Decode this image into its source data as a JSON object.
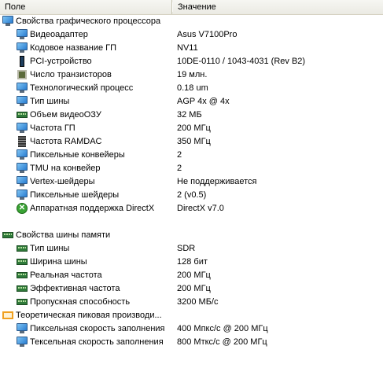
{
  "header": {
    "name_col": "Поле",
    "value_col": "Значение"
  },
  "groups": [
    {
      "title": "Свойства графического процессора",
      "icon": "monitor-icon",
      "items": [
        {
          "label": "Видеоадаптер",
          "value": "Asus V7100Pro",
          "icon": "monitor-icon"
        },
        {
          "label": "Кодовое название ГП",
          "value": "NV11",
          "icon": "monitor-icon"
        },
        {
          "label": "PCI-устройство",
          "value": "10DE-0110 / 1043-4031  (Rev B2)",
          "icon": "pci-slot-icon"
        },
        {
          "label": "Число транзисторов",
          "value": "19 млн.",
          "icon": "chip-icon"
        },
        {
          "label": "Технологический процесс",
          "value": "0.18 um",
          "icon": "monitor-icon"
        },
        {
          "label": "Тип шины",
          "value": "AGP 4x @ 4x",
          "icon": "monitor-icon"
        },
        {
          "label": "Объем видеоОЗУ",
          "value": "32 МБ",
          "icon": "memory-icon"
        },
        {
          "label": "Частота ГП",
          "value": "200 МГц",
          "icon": "monitor-icon"
        },
        {
          "label": "Частота RAMDAC",
          "value": "350 МГц",
          "icon": "ramdac-icon"
        },
        {
          "label": "Пиксельные конвейеры",
          "value": "2",
          "icon": "monitor-icon"
        },
        {
          "label": "TMU на конвейер",
          "value": "2",
          "icon": "monitor-icon"
        },
        {
          "label": "Vertex-шейдеры",
          "value": "Не поддерживается",
          "icon": "monitor-icon"
        },
        {
          "label": "Пиксельные шейдеры",
          "value": "2  (v0.5)",
          "icon": "monitor-icon"
        },
        {
          "label": "Аппаратная поддержка DirectX",
          "value": "DirectX v7.0",
          "icon": "xbox-icon"
        }
      ]
    },
    {
      "title": "Свойства шины памяти",
      "icon": "memory-icon",
      "items": [
        {
          "label": "Тип шины",
          "value": "SDR",
          "icon": "memory-icon"
        },
        {
          "label": "Ширина шины",
          "value": "128 бит",
          "icon": "memory-icon"
        },
        {
          "label": "Реальная частота",
          "value": "200 МГц",
          "icon": "memory-icon"
        },
        {
          "label": "Эффективная частота",
          "value": "200 МГц",
          "icon": "memory-icon"
        },
        {
          "label": "Пропускная способность",
          "value": "3200 МБ/с",
          "icon": "memory-icon"
        }
      ]
    },
    {
      "title": "Теоретическая пиковая производи...",
      "icon": "performance-icon",
      "items": [
        {
          "label": "Пиксельная скорость заполнения",
          "value": "400 Мпкс/с @ 200 МГц",
          "icon": "monitor-icon"
        },
        {
          "label": "Тексельная скорость заполнения",
          "value": "800 Мткс/с @ 200 МГц",
          "icon": "monitor-icon"
        }
      ]
    }
  ]
}
